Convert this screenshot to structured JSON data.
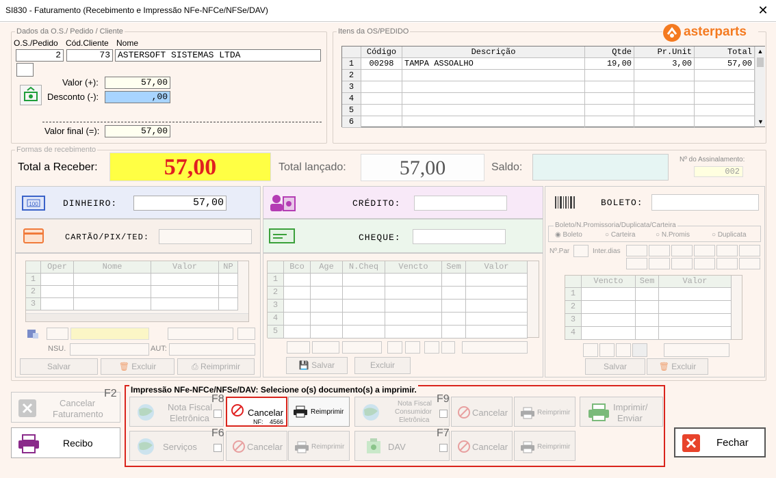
{
  "window": {
    "title": "SI830 - Faturamento (Recebimento e Impressão NFe-NFCe/NFSe/DAV)",
    "close": "✕"
  },
  "brand": {
    "logo": "asterparts"
  },
  "dados": {
    "title": "Dados da O.S./ Pedido / Cliente",
    "col_os": "O.S./Pedido",
    "col_cod": "Cód.Cliente",
    "col_nome": "Nome",
    "os": "2",
    "cod": "73",
    "nome": "ASTERSOFT SISTEMAS LTDA",
    "valor_label": "Valor (+):",
    "valor": "57,00",
    "desconto_label": "Desconto (-):",
    "desconto": ",00",
    "valor_final_label": "Valor final (=):",
    "valor_final": "57,00"
  },
  "itens": {
    "title": "Itens da OS/PEDIDO",
    "headers": [
      "Código",
      "Descrição",
      "Qtde",
      "Pr.Unit",
      "Total"
    ],
    "rows": [
      {
        "n": "1",
        "codigo": "00298",
        "descricao": "TAMPA ASSOALHO",
        "qtde": "19,00",
        "unit": "3,00",
        "total": "57,00"
      },
      {
        "n": "2",
        "codigo": "",
        "descricao": "",
        "qtde": "",
        "unit": "",
        "total": ""
      },
      {
        "n": "3",
        "codigo": "",
        "descricao": "",
        "qtde": "",
        "unit": "",
        "total": ""
      },
      {
        "n": "4",
        "codigo": "",
        "descricao": "",
        "qtde": "",
        "unit": "",
        "total": ""
      },
      {
        "n": "5",
        "codigo": "",
        "descricao": "",
        "qtde": "",
        "unit": "",
        "total": ""
      },
      {
        "n": "6",
        "codigo": "",
        "descricao": "",
        "qtde": "",
        "unit": "",
        "total": ""
      }
    ]
  },
  "formas": {
    "title": "Formas de recebimento",
    "total_receber_label": "Total a Receber:",
    "total_receber": "57,00",
    "total_lancado_label": "Total lançado:",
    "total_lancado": "57,00",
    "saldo_label": "Saldo:",
    "saldo": "",
    "assinalamento_label": "Nº do Assinalamento:",
    "assinalamento": "002"
  },
  "dinheiro": {
    "label": "DINHEIRO:",
    "value": "57,00"
  },
  "cartao": {
    "label": "CARTÃO/PIX/TED:",
    "headers": [
      "Oper",
      "Nome",
      "Valor",
      "NP"
    ],
    "rows": [
      "1",
      "2",
      "3"
    ],
    "nsu": "NSU.",
    "aut": "AUT:",
    "salvar": "Salvar",
    "excluir": "Excluir",
    "reimprimir": "Reimprimir"
  },
  "credito": {
    "label": "CRÉDITO:"
  },
  "cheque": {
    "label": "CHEQUE:",
    "headers": [
      "Bco",
      "Age",
      "N.Cheq",
      "Vencto",
      "Sem",
      "Valor"
    ],
    "rows": [
      "1",
      "2",
      "3",
      "4",
      "5"
    ],
    "salvar": "Salvar",
    "excluir": "Excluir"
  },
  "boleto": {
    "label": "BOLETO:",
    "group": "Boleto/N.Promissoria/Duplicata/Carteira",
    "options": [
      "Boleto",
      "Carteira",
      "N.Promis",
      "Duplicata"
    ],
    "npar": "Nº.Par",
    "interdias": "Inter.dias",
    "headers": [
      "Vencto",
      "Sem",
      "Valor"
    ],
    "rows": [
      "1",
      "2",
      "3",
      "4"
    ],
    "salvar": "Salvar",
    "excluir": "Excluir"
  },
  "cancelar_fat": {
    "label1": "Cancelar",
    "label2": "Faturamento",
    "key": "F2"
  },
  "recibo": {
    "label": "Recibo"
  },
  "impressao": {
    "title": "Impressão NFe-NFCe/NFSe/DAV: Selecione o(s) documento(s) a imprimir.",
    "nfe": {
      "label1": "Nota Fiscal",
      "label2": "Eletrônica",
      "key": "F8",
      "cancelar": "Cancelar",
      "nf": "NF:",
      "nfnum": "4566",
      "reimprimir": "Reimprimir"
    },
    "nfce": {
      "label1": "Nota Fiscal",
      "label2": "Consumidor",
      "label3": "Eletrônica",
      "key": "F9",
      "cancelar": "Cancelar",
      "reimprimir": "Reimprimir"
    },
    "imprimir": {
      "label1": "Imprimir/",
      "label2": "Enviar"
    },
    "servicos": {
      "label": "Serviços",
      "key": "F6",
      "cancelar": "Cancelar",
      "reimprimir": "Reimprimir"
    },
    "dav": {
      "label": "DAV",
      "key": "F7",
      "cancelar": "Cancelar",
      "reimprimir": "Reimprimir"
    }
  },
  "fechar": {
    "label": "Fechar"
  },
  "colors": {
    "accent_red": "#d9241c",
    "yellow": "#ffff44",
    "orange": "#f47a20"
  }
}
